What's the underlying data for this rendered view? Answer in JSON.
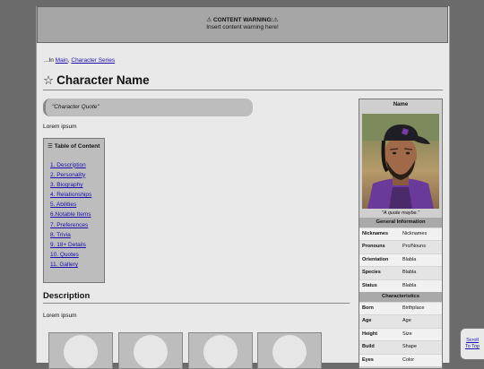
{
  "warning": {
    "title": "⚠ CONTENT WARNING:⚠",
    "text": "Insert content warning here!"
  },
  "breadcrumb": {
    "prefix": "...In ",
    "links": [
      "Main",
      "Character Series"
    ],
    "separator": ", "
  },
  "page": {
    "star": "☆",
    "title": "Character Name",
    "quote": "\"Character Quote\"",
    "intro": "Lorem ipsum"
  },
  "toc": {
    "title": "☰ Table of Content",
    "items": [
      "1. Description",
      "2. Personality",
      "3. Biography",
      "4. Relationships",
      "5. Abilities",
      "6.Notable Items",
      "7. Preferences",
      "8. Trivia",
      "9. 18+ Details",
      "10. Quotes",
      "11. Gallery"
    ]
  },
  "description": {
    "heading": "Description",
    "text": "Lorem ipsum"
  },
  "gallery": {
    "count": 4
  },
  "infobox": {
    "name": "Name",
    "caption": "\"A quote maybe.\"",
    "general_header": "General Information",
    "general": [
      {
        "key": "Nicknames",
        "value": "Nicknames"
      },
      {
        "key": "Pronouns",
        "value": "Pro/Nouns"
      },
      {
        "key": "Orientation",
        "value": "Blabla"
      },
      {
        "key": "Species",
        "value": "Blabla"
      },
      {
        "key": "Status",
        "value": "Blabla"
      }
    ],
    "characteristics_header": "Characteristics",
    "characteristics": [
      {
        "key": "Born",
        "value": "Birthplace"
      },
      {
        "key": "Age",
        "value": "Age"
      },
      {
        "key": "Height",
        "value": "Size"
      },
      {
        "key": "Build",
        "value": "Shape"
      },
      {
        "key": "Eyes",
        "value": "Color"
      }
    ]
  },
  "scrolltop": {
    "line1": "Scroll",
    "line2": "To Top"
  },
  "colors": {
    "link": "#1a0dab",
    "page_bg": "#e9e9e9",
    "outer_bg": "#6b6b6b"
  }
}
